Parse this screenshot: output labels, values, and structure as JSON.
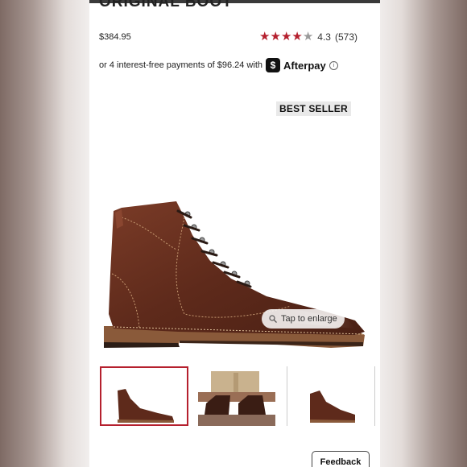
{
  "product": {
    "title": "ORIGINAL BOOT",
    "price": "$384.95",
    "rating_value": "4.3",
    "review_count": "(573)",
    "stars_filled": 4,
    "stars_total": 5
  },
  "afterpay": {
    "text": "or 4 interest-free payments of $96.24 with",
    "brand": "Afterpay",
    "logo_glyph": "$",
    "info_glyph": "i"
  },
  "badge": "BEST SELLER",
  "gallery": {
    "tap_label": "Tap to enlarge",
    "thumbnails": [
      "boot-side-view",
      "boots-worn-view",
      "boot-angle-view"
    ],
    "selected_index": 0
  },
  "feedback_label": "Feedback",
  "colors": {
    "accent_red": "#b5202e",
    "leather_brown": "#6e3322",
    "sole_brown": "#8a5a3a"
  },
  "icons": [
    "star-icon",
    "afterpay-logo-icon",
    "info-icon",
    "magnifier-icon"
  ]
}
